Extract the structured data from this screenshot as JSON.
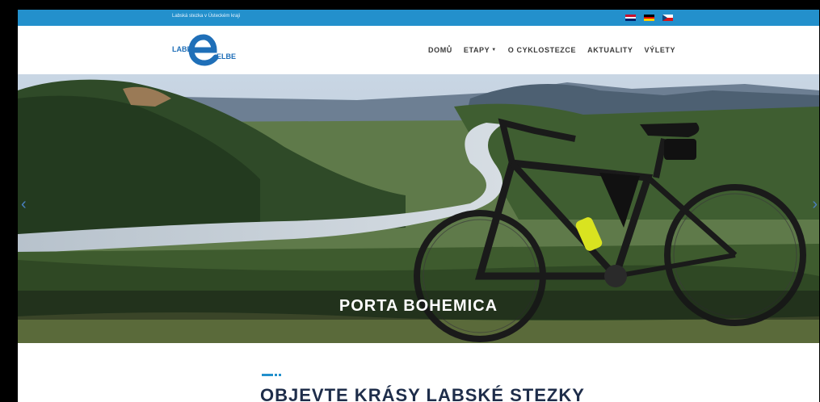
{
  "topbar": {
    "text": "Labská stezka v Ústeckém kraji",
    "languages": [
      {
        "name": "english-flag"
      },
      {
        "name": "german-flag"
      },
      {
        "name": "czech-flag"
      }
    ]
  },
  "header": {
    "logo": {
      "left_text": "LABE",
      "right_text": "ELBE"
    },
    "nav": [
      {
        "label": "DOMŮ"
      },
      {
        "label": "ETAPY"
      },
      {
        "label": "O CYKLOSTEZCE"
      },
      {
        "label": "AKTUALITY"
      },
      {
        "label": "VÝLETY"
      }
    ]
  },
  "hero": {
    "caption": "PORTA BOHEMICA",
    "prev_icon": "chevron-left-icon",
    "next_icon": "chevron-right-icon"
  },
  "section": {
    "title": "OBJEVTE KRÁSY LABSKÉ STEZKY"
  },
  "colors": {
    "accent": "#2390cc",
    "logo_blue": "#1f6fb8",
    "title": "#1e2d4a"
  }
}
